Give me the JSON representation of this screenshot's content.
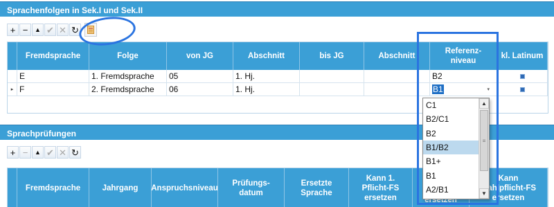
{
  "section1": {
    "title": "Sprachenfolgen in Sek.I und Sek.II",
    "toolbar": {
      "add": "+",
      "remove": "−",
      "up": "▲",
      "confirm": "✔",
      "cancel": "✕",
      "refresh": "↻"
    },
    "columns": [
      "Fremdsprache",
      "Folge",
      "von JG",
      "Abschnitt",
      "bis JG",
      "Abschnitt",
      "Referenz-\nniveau",
      "kl. Latinum"
    ],
    "rows": [
      {
        "indicator": "",
        "fremdsprache": "E",
        "folge": "1. Fremdsprache",
        "von_jg": "05",
        "abschnitt": "1. Hj.",
        "bis_jg": "",
        "abschnitt2": "",
        "referenz": "B2",
        "latinum": true
      },
      {
        "indicator": "▸",
        "fremdsprache": "F",
        "folge": "2. Fremdsprache",
        "von_jg": "06",
        "abschnitt": "1. Hj.",
        "bis_jg": "",
        "abschnitt2": "",
        "referenz": "B1",
        "latinum": true
      }
    ]
  },
  "dropdown": {
    "options": [
      "C1",
      "B2/C1",
      "B2",
      "B1/B2",
      "B1+",
      "B1",
      "A2/B1"
    ],
    "selected": "B1/B2"
  },
  "section2": {
    "title": "Sprachprüfungen",
    "toolbar": {
      "add": "+",
      "remove": "−",
      "up": "▲",
      "confirm": "✔",
      "cancel": "✕",
      "refresh": "↻"
    },
    "columns": [
      "Fremdsprache",
      "Jahrgang",
      "Anspruchsniveau",
      "Prüfungs-\ndatum",
      "Ersetzte\nSprache",
      "Kann 1.\nPflicht-FS\nersetzen",
      "Kann\nersetzen",
      "Kann\nWahlpflicht-FS\nersetzen"
    ]
  },
  "colors": {
    "header_blue": "#3b9fd6",
    "annotation_blue": "#2b74e0",
    "selected_row": "#bcd9ee"
  }
}
